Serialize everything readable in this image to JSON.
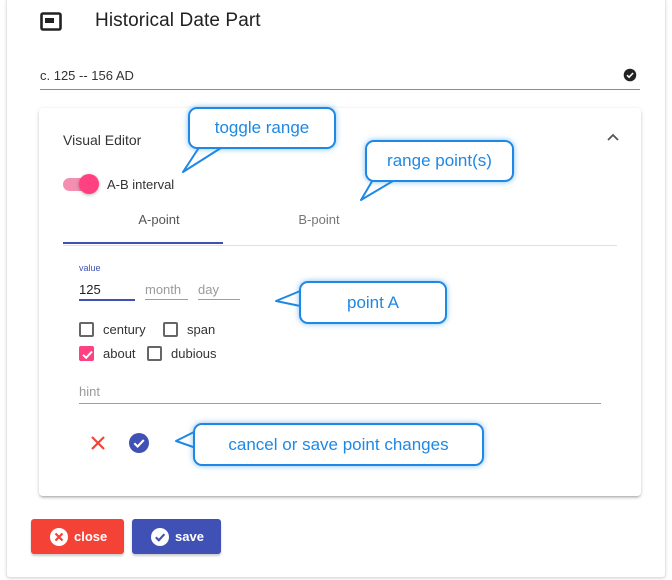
{
  "header": {
    "title": "Historical Date Part",
    "icon": "window-icon"
  },
  "date": {
    "value": "c. 125 -- 156 AD",
    "status_icon": "check-circle-icon"
  },
  "editor": {
    "title": "Visual Editor",
    "collapse_icon": "chevron-up-icon",
    "range_toggle": {
      "label": "A-B interval",
      "on": true
    },
    "tabs": [
      {
        "label": "A-point",
        "active": true
      },
      {
        "label": "B-point",
        "active": false
      }
    ],
    "point": {
      "value_label": "value",
      "value": "125",
      "month_placeholder": "month",
      "day_placeholder": "day",
      "checkboxes": [
        {
          "label": "century",
          "checked": false
        },
        {
          "label": "span",
          "checked": false
        },
        {
          "label": "about",
          "checked": true
        },
        {
          "label": "dubious",
          "checked": false
        }
      ],
      "hint_placeholder": "hint"
    }
  },
  "actions": {
    "close_label": "close",
    "save_label": "save"
  },
  "callouts": {
    "toggle_range": "toggle range",
    "range_points": "range point(s)",
    "point_a": "point A",
    "cancel_save": "cancel or save point changes"
  },
  "colors": {
    "primary": "#3f51b5",
    "accent": "#ff4081",
    "warn": "#f44336",
    "callout": "#1e88e5"
  }
}
